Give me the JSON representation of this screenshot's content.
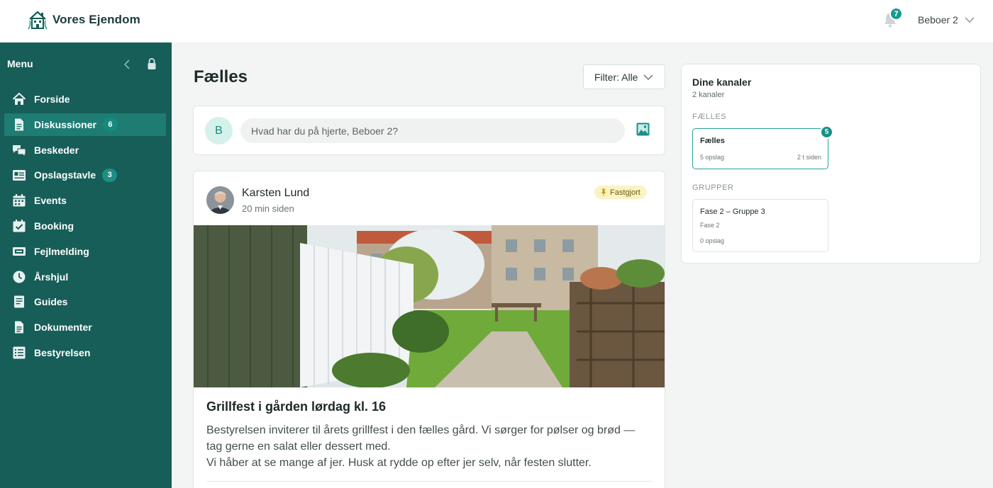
{
  "app": {
    "brand_name": "Vores Ejendom",
    "brand_color": "#175e58",
    "accent_color": "#1a9a8d"
  },
  "header": {
    "notification_count": "7",
    "user_name": "Beboer 2"
  },
  "sidebar": {
    "title": "Menu",
    "items": [
      {
        "label": "Forside",
        "icon": "home-icon"
      },
      {
        "label": "Diskussioner",
        "icon": "document-icon",
        "badge": "6",
        "active": true
      },
      {
        "label": "Beskeder",
        "icon": "chat-icon"
      },
      {
        "label": "Opslagstavle",
        "icon": "board-icon",
        "badge": "3"
      },
      {
        "label": "Events",
        "icon": "calendar-icon"
      },
      {
        "label": "Booking",
        "icon": "calendar-check-icon"
      },
      {
        "label": "Fejlmelding",
        "icon": "wrench-icon"
      },
      {
        "label": "Årshjul",
        "icon": "clock-icon"
      },
      {
        "label": "Guides",
        "icon": "guide-icon"
      },
      {
        "label": "Dokumenter",
        "icon": "file-icon"
      },
      {
        "label": "Bestyrelsen",
        "icon": "list-icon"
      }
    ]
  },
  "main": {
    "title": "Fælles",
    "filter_label": "Filter: Alle",
    "composer": {
      "avatar_initial": "B",
      "placeholder": "Hvad har du på hjerte, Beboer 2?"
    },
    "post": {
      "author": "Karsten Lund",
      "time": "20 min siden",
      "pinned_label": "Fastgjort",
      "title": "Grillfest i gården lørdag kl. 16",
      "body_line1": "Bestyrelsen inviterer til årets grillfest i den fælles gård. Vi sørger for pølser og brød — tag gerne en salat eller dessert med.",
      "body_line2": "Vi håber at se mange af jer. Husk at rydde op efter jer selv, når festen slutter."
    }
  },
  "channels": {
    "title": "Dine kanaler",
    "count": "2 kanaler",
    "sections": [
      {
        "label": "FÆLLES",
        "cards": [
          {
            "name": "Fælles",
            "posts": "5 opslag",
            "time": "2 t siden",
            "badge": "5"
          }
        ]
      },
      {
        "label": "GRUPPER",
        "cards": [
          {
            "name": "Fase 2 – Gruppe 3",
            "sub": "Fase 2",
            "posts": "0 opslag"
          }
        ]
      }
    ]
  }
}
